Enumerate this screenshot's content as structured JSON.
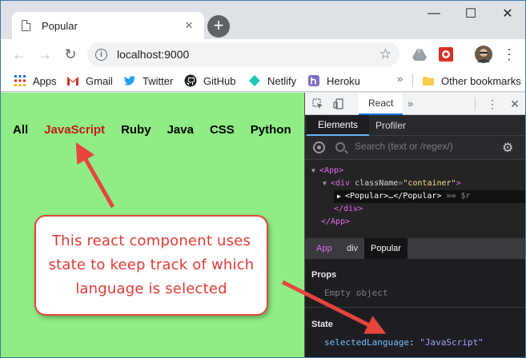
{
  "browser": {
    "tab_title": "Popular",
    "tab_close": "×",
    "new_tab": "+",
    "url": "localhost:9000",
    "window_minimize": "—",
    "window_maximize": "☐",
    "window_close": "✕"
  },
  "bookmarks": {
    "items": [
      {
        "label": "Apps",
        "icon": "apps-grid-icon"
      },
      {
        "label": "Gmail",
        "icon": "gmail-icon"
      },
      {
        "label": "Twitter",
        "icon": "twitter-icon"
      },
      {
        "label": "GitHub",
        "icon": "github-icon"
      },
      {
        "label": "Netlify",
        "icon": "netlify-icon"
      },
      {
        "label": "Heroku",
        "icon": "heroku-icon"
      }
    ],
    "overflow": "»",
    "other": "Other bookmarks"
  },
  "page": {
    "languages": [
      "All",
      "JavaScript",
      "Ruby",
      "Java",
      "CSS",
      "Python"
    ],
    "selected_language": "JavaScript"
  },
  "devtools": {
    "active_panel": "React",
    "more": "»",
    "react_tabs": [
      "Elements",
      "Profiler"
    ],
    "search_placeholder": "Search (text or /regex/)",
    "tree": {
      "root_open": "<App>",
      "div_tag": "<div",
      "div_attr": "className",
      "div_eq": "=",
      "div_val": "\"container\"",
      "div_close_bracket": ">",
      "popular": "<Popular>…</Popular>",
      "popular_ref": "== $r",
      "div_end": "</div>",
      "root_end": "</App>"
    },
    "breadcrumbs": [
      "App",
      "div",
      "Popular"
    ],
    "props_header": "Props",
    "props_value": "Empty object",
    "state_header": "State",
    "state_key": "selectedLanguage",
    "state_colon": ":",
    "state_value": "\"JavaScript\""
  },
  "callout": {
    "text": "This react component uses state to keep track of which language is selected"
  },
  "colors": {
    "page_bg": "#90ec84",
    "active_language": "#c01a1a",
    "callout_border": "#e0473f",
    "arrow": "#e8453c"
  }
}
